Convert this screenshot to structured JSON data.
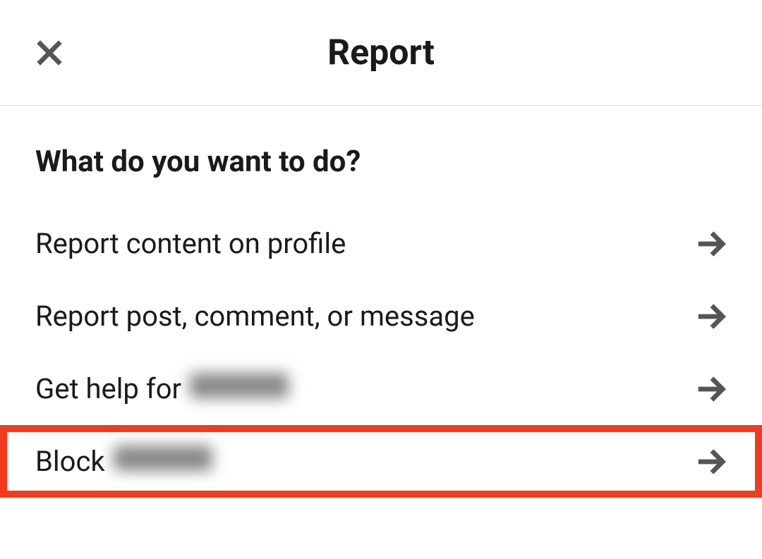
{
  "header": {
    "title": "Report"
  },
  "section": {
    "heading": "What do you want to do?"
  },
  "options": [
    {
      "label": "Report content on profile",
      "hasRedacted": false
    },
    {
      "label": "Report post, comment, or message",
      "hasRedacted": false
    },
    {
      "label": "Get help for",
      "hasRedacted": true
    },
    {
      "label": "Block",
      "hasRedacted": true,
      "highlighted": true
    }
  ],
  "icons": {
    "close": "close-icon",
    "arrow": "arrow-right-icon"
  },
  "colors": {
    "highlight": "#f13b1c",
    "text": "#1a1a1a",
    "iconStroke": "#555555",
    "divider": "#e0e0e0"
  }
}
